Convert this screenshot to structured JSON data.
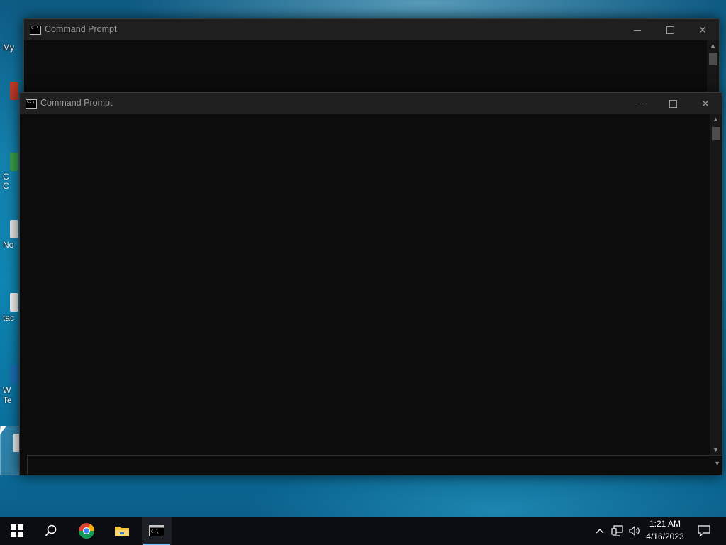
{
  "desktop": {
    "icons": [
      {
        "label": "My"
      },
      {
        "label": ""
      },
      {
        "label": "C\nC"
      },
      {
        "label": "No"
      },
      {
        "label": "tac"
      },
      {
        "label": "W\nTe"
      }
    ]
  },
  "windows": [
    {
      "title": "Command Prompt"
    },
    {
      "title": "Command Prompt"
    }
  ],
  "taskbar": {
    "apps": [
      "start",
      "search",
      "chrome",
      "file-explorer",
      "command-prompt"
    ],
    "clock": {
      "time": "1:21 AM",
      "date": "4/16/2023"
    }
  },
  "colors": {
    "console_bg": "#0c0c0c",
    "titlebar_bg": "#1f1f1f",
    "taskbar_bg": "#0b0d12",
    "active_indicator": "#76b9ed"
  },
  "icons": {
    "start": "windows-logo-icon",
    "search": "search-icon",
    "chrome": "chrome-icon",
    "explorer": "folder-icon",
    "cmd": "cmd-icon",
    "tray_chevron": "chevron-up-icon",
    "network": "network-icon",
    "volume": "volume-icon",
    "notifications": "notification-icon"
  }
}
